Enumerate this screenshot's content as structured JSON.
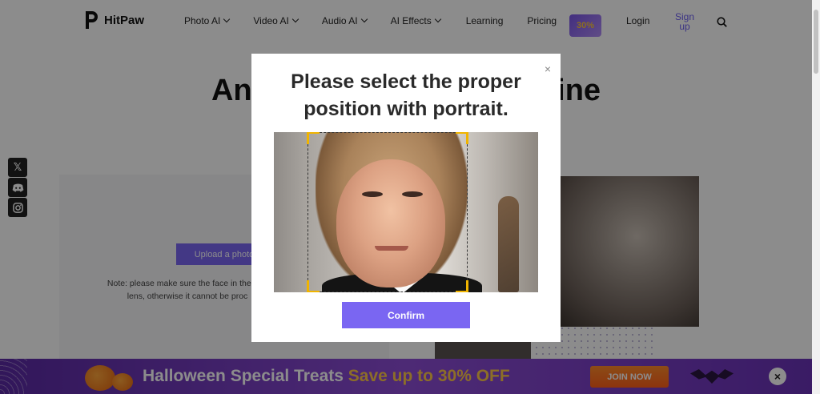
{
  "header": {
    "brand": "HitPaw",
    "nav": [
      {
        "label": "Photo AI",
        "has_dropdown": true
      },
      {
        "label": "Video AI",
        "has_dropdown": true
      },
      {
        "label": "Audio AI",
        "has_dropdown": true
      },
      {
        "label": "AI Effects",
        "has_dropdown": true
      },
      {
        "label": "Learning",
        "has_dropdown": false
      },
      {
        "label": "Pricing",
        "has_dropdown": false
      }
    ],
    "promo_badge": "30%",
    "login": "Login",
    "signup_line1": "Sign",
    "signup_line2": "up",
    "search_icon": "search-icon"
  },
  "page": {
    "title_left": "Ani",
    "title_right": "ine",
    "upload_button": "Upload a photo",
    "note_line1": "Note: please make sure the face in the pho",
    "note_line2": "lens, otherwise it cannot be proc",
    "social": [
      "x-icon",
      "discord-icon",
      "instagram-icon"
    ]
  },
  "modal": {
    "title_line1": "Please select the proper",
    "title_line2": "position with portrait.",
    "close": "×",
    "confirm": "Confirm",
    "crop_accent": "#f0b400"
  },
  "banner": {
    "text_part1": "Halloween Special Treats",
    "text_part2": "Save up to",
    "text_part3": "30% OFF",
    "cta": "JOIN NOW",
    "close": "×"
  },
  "colors": {
    "accent": "#7a66f2",
    "banner": "#7b3fc4",
    "cta": "#ff6a1f"
  }
}
